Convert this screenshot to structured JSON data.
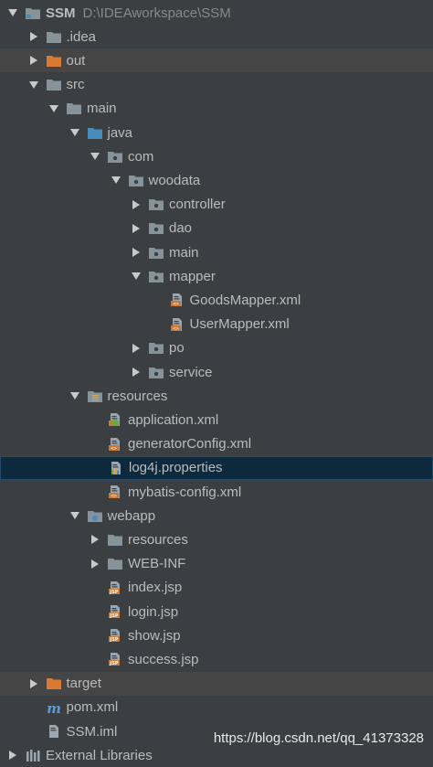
{
  "project": {
    "name": "SSM",
    "path": "D:\\IDEAworkspace\\SSM"
  },
  "tree": [
    {
      "label": "SSM",
      "arrow": "down",
      "icon": "project-folder-icon",
      "level": 0,
      "project": true
    },
    {
      "label": ".idea",
      "arrow": "right",
      "icon": "folder-icon",
      "level": 1
    },
    {
      "label": "out",
      "arrow": "right",
      "icon": "excluded-folder-icon",
      "level": 1,
      "excluded": true
    },
    {
      "label": "src",
      "arrow": "down",
      "icon": "folder-icon",
      "level": 1
    },
    {
      "label": "main",
      "arrow": "down",
      "icon": "folder-icon",
      "level": 2
    },
    {
      "label": "java",
      "arrow": "down",
      "icon": "source-folder-icon",
      "level": 3
    },
    {
      "label": "com",
      "arrow": "down",
      "icon": "package-icon",
      "level": 4
    },
    {
      "label": "woodata",
      "arrow": "down",
      "icon": "package-icon",
      "level": 5
    },
    {
      "label": "controller",
      "arrow": "right",
      "icon": "package-icon",
      "level": 6
    },
    {
      "label": "dao",
      "arrow": "right",
      "icon": "package-icon",
      "level": 6
    },
    {
      "label": "main",
      "arrow": "right",
      "icon": "package-icon",
      "level": 6
    },
    {
      "label": "mapper",
      "arrow": "down",
      "icon": "package-icon",
      "level": 6
    },
    {
      "label": "GoodsMapper.xml",
      "arrow": "none",
      "icon": "xml-file-icon",
      "level": 7
    },
    {
      "label": "UserMapper.xml",
      "arrow": "none",
      "icon": "xml-file-icon",
      "level": 7
    },
    {
      "label": "po",
      "arrow": "right",
      "icon": "package-icon",
      "level": 6
    },
    {
      "label": "service",
      "arrow": "right",
      "icon": "package-icon",
      "level": 6
    },
    {
      "label": "resources",
      "arrow": "down",
      "icon": "resources-folder-icon",
      "level": 3
    },
    {
      "label": "application.xml",
      "arrow": "none",
      "icon": "spring-xml-file-icon",
      "level": 4
    },
    {
      "label": "generatorConfig.xml",
      "arrow": "none",
      "icon": "xml-file-icon",
      "level": 4
    },
    {
      "label": "log4j.properties",
      "arrow": "none",
      "icon": "properties-file-icon",
      "level": 4,
      "selected": true
    },
    {
      "label": "mybatis-config.xml",
      "arrow": "none",
      "icon": "xml-file-icon",
      "level": 4
    },
    {
      "label": "webapp",
      "arrow": "down",
      "icon": "web-folder-icon",
      "level": 3
    },
    {
      "label": "resources",
      "arrow": "right",
      "icon": "folder-icon",
      "level": 4
    },
    {
      "label": "WEB-INF",
      "arrow": "right",
      "icon": "folder-icon",
      "level": 4
    },
    {
      "label": "index.jsp",
      "arrow": "none",
      "icon": "jsp-file-icon",
      "level": 4
    },
    {
      "label": "login.jsp",
      "arrow": "none",
      "icon": "jsp-file-icon",
      "level": 4
    },
    {
      "label": "show.jsp",
      "arrow": "none",
      "icon": "jsp-file-icon",
      "level": 4
    },
    {
      "label": "success.jsp",
      "arrow": "none",
      "icon": "jsp-file-icon",
      "level": 4
    },
    {
      "label": "target",
      "arrow": "right",
      "icon": "excluded-folder-icon",
      "level": 1,
      "excluded": true
    },
    {
      "label": "pom.xml",
      "arrow": "none",
      "icon": "maven-file-icon",
      "level": 1
    },
    {
      "label": "SSM.iml",
      "arrow": "none",
      "icon": "iml-file-icon",
      "level": 1
    },
    {
      "label": "External Libraries",
      "arrow": "right",
      "icon": "libraries-icon",
      "level": 0
    }
  ],
  "watermark": "https://blog.csdn.net/qq_41373328",
  "colors": {
    "background": "#3c3f41",
    "selection": "#0d293e",
    "excluded_row": "#454545",
    "folder": "#87939a",
    "source_folder": "#4a8bbd",
    "excluded_folder": "#d87a33",
    "xml_icon": "#cc7832"
  }
}
